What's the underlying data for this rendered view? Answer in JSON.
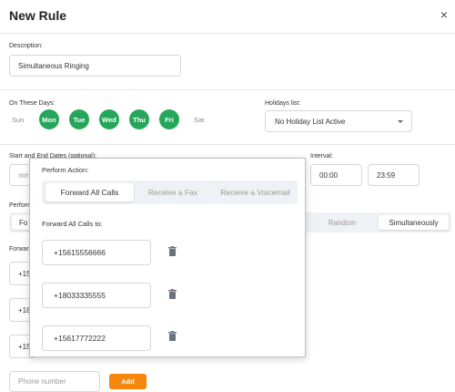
{
  "header": {
    "title": "New Rule",
    "close_label": "×"
  },
  "description": {
    "label": "Description:",
    "value": "Simultaneous Ringing"
  },
  "days": {
    "label": "On These Days:",
    "items": [
      {
        "label": "Sun",
        "active": false
      },
      {
        "label": "Mon",
        "active": true
      },
      {
        "label": "Tue",
        "active": true
      },
      {
        "label": "Wed",
        "active": true
      },
      {
        "label": "Thu",
        "active": true
      },
      {
        "label": "Fri",
        "active": true
      },
      {
        "label": "Sat",
        "active": false
      }
    ]
  },
  "holidays": {
    "label": "Holidays list:",
    "selected": "No Holiday List Active"
  },
  "dates": {
    "label": "Start and End Dates (optional):",
    "placeholder": "mm"
  },
  "interval": {
    "label": "Interval:",
    "start": "00:00",
    "end": "23:59"
  },
  "perform_bg": {
    "label": "Perform",
    "left_item": "Fo",
    "items": [
      "Random",
      "Simultaneously"
    ],
    "active": "Simultaneously"
  },
  "forward_bg": {
    "label": "Forwar",
    "partials": [
      "+15",
      "+18",
      "+15"
    ],
    "phone_placeholder": "Phone number",
    "add_label": "Add"
  },
  "popup": {
    "action_label": "Perform Action:",
    "tabs": [
      "Forward All Calls",
      "Receive a Fax",
      "Receive a Voicemail"
    ],
    "active_tab": "Forward All Calls",
    "forward_label": "Forward All Calls to:",
    "numbers": [
      "+15615556666",
      "+18033335555",
      "+15617772222"
    ]
  },
  "colors": {
    "day_active": "#26a65b",
    "add_button": "#f4870c"
  },
  "icons": {
    "close": "close-icon",
    "dropdown": "chevron-down-icon",
    "delete": "trash-icon"
  }
}
